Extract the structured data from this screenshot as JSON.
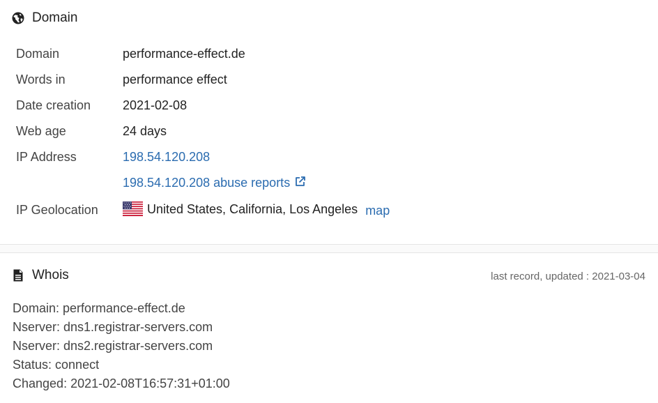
{
  "domain_section": {
    "title": "Domain",
    "icon": "globe-icon",
    "rows": {
      "domain": {
        "label": "Domain",
        "value": "performance-effect.de"
      },
      "words_in": {
        "label": "Words in",
        "value": "performance effect"
      },
      "date_creation": {
        "label": "Date creation",
        "value": "2021-02-08"
      },
      "web_age": {
        "label": "Web age",
        "value": "24 days"
      },
      "ip_address": {
        "label": "IP Address",
        "value": "198.54.120.208"
      },
      "abuse_reports": {
        "label": "",
        "value": "198.54.120.208 abuse reports"
      },
      "ip_geolocation": {
        "label": "IP Geolocation",
        "value": "United States, California, Los Angeles",
        "map_link": "map",
        "flag": "us-flag-icon"
      }
    }
  },
  "whois_section": {
    "title": "Whois",
    "icon": "document-icon",
    "last_record": "last record, updated : 2021-03-04",
    "lines": [
      "Domain: performance-effect.de",
      "Nserver: dns1.registrar-servers.com",
      "Nserver: dns2.registrar-servers.com",
      "Status: connect",
      "Changed: 2021-02-08T16:57:31+01:00"
    ]
  },
  "colors": {
    "link": "#2b6cb0",
    "text": "#222222",
    "label": "#444444",
    "muted": "#666666"
  }
}
